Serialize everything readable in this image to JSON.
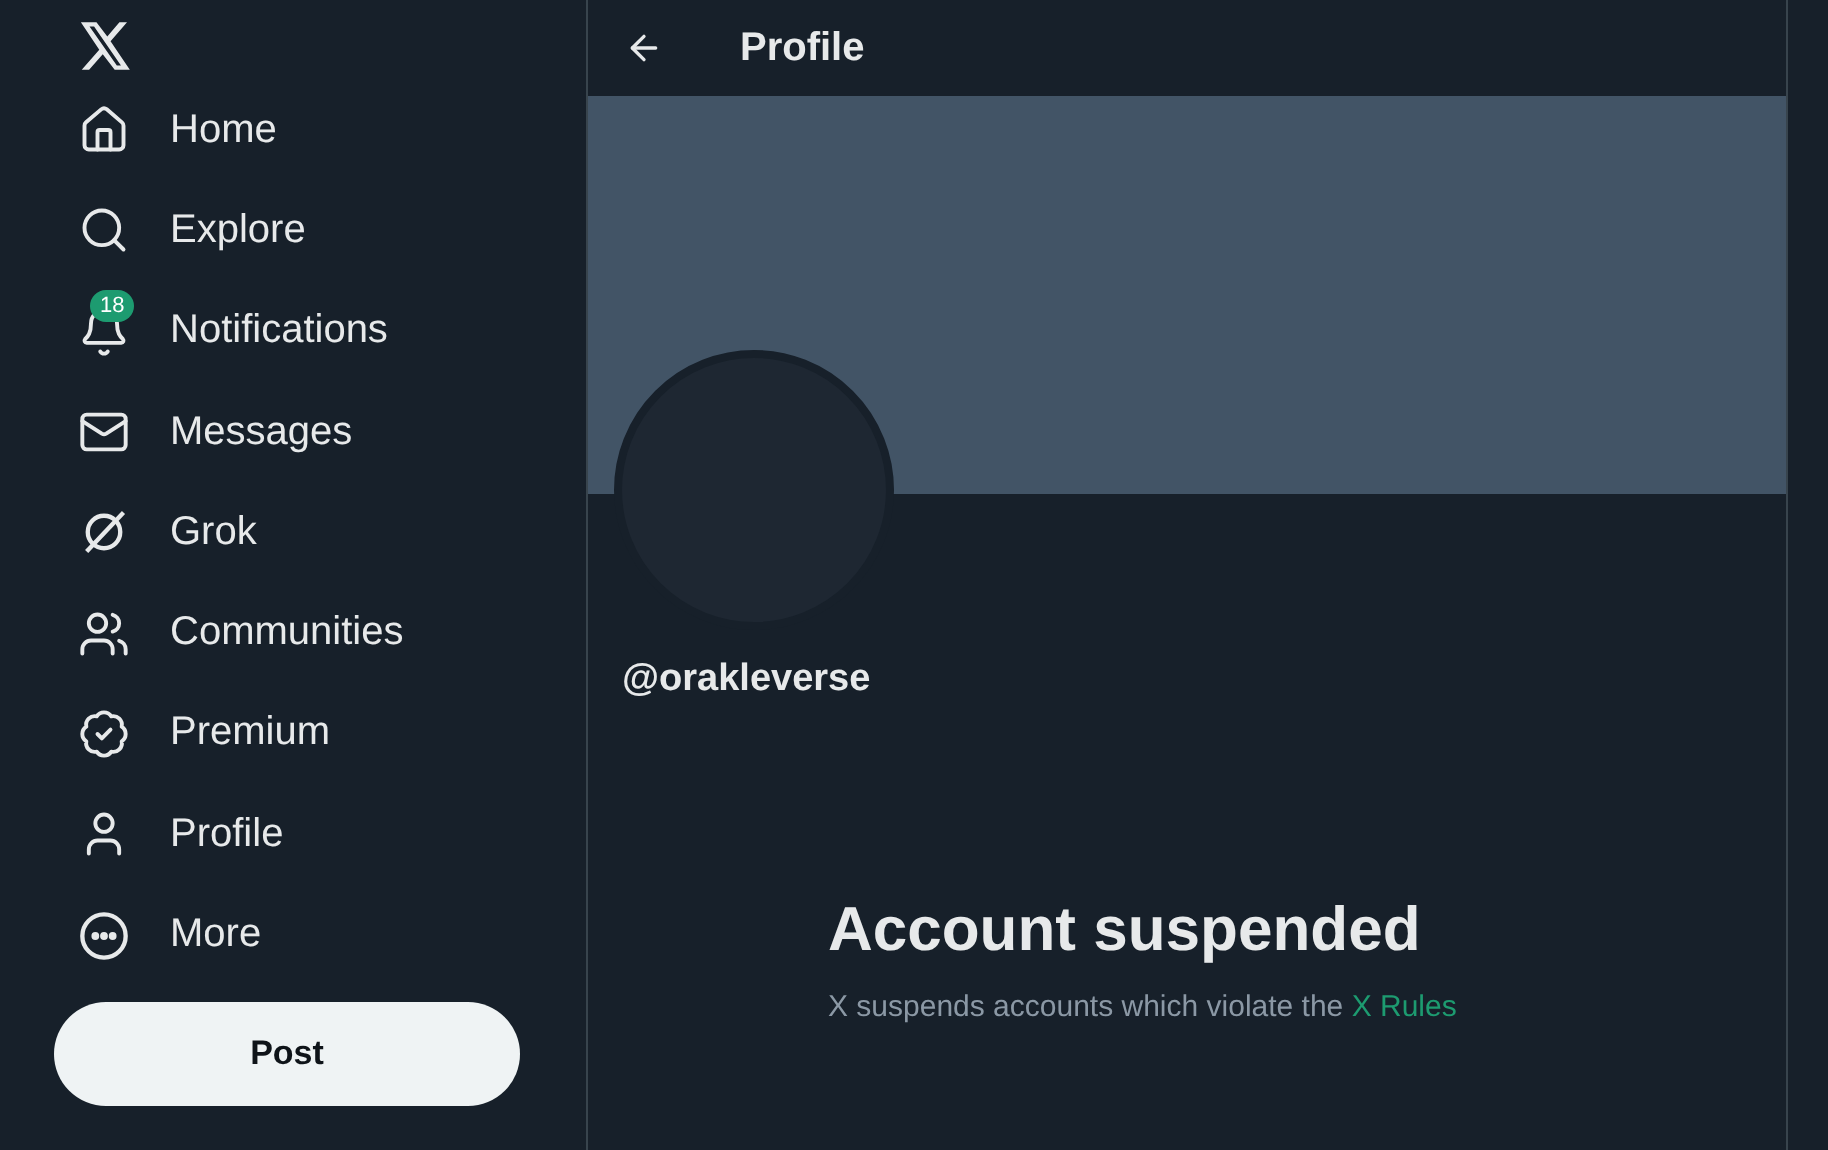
{
  "sidebar": {
    "items": [
      {
        "kind": "home",
        "label": "Home",
        "selected": false
      },
      {
        "kind": "explore",
        "label": "Explore",
        "selected": false
      },
      {
        "kind": "notifications",
        "label": "Notifications",
        "selected": false,
        "badge": "18"
      },
      {
        "kind": "messages",
        "label": "Messages",
        "selected": false
      },
      {
        "kind": "grok",
        "label": "Grok",
        "selected": false
      },
      {
        "kind": "communities",
        "label": "Communities",
        "selected": false
      },
      {
        "kind": "premium",
        "label": "Premium",
        "selected": false
      },
      {
        "kind": "profile",
        "label": "Profile",
        "selected": false
      },
      {
        "kind": "more",
        "label": "More",
        "selected": false
      }
    ],
    "post_button": "Post"
  },
  "header": {
    "title": "Profile"
  },
  "profile": {
    "handle": "@orakleverse"
  },
  "notice": {
    "title": "Account suspended",
    "text": "X suspends accounts which violate the ",
    "link": "X Rules"
  }
}
